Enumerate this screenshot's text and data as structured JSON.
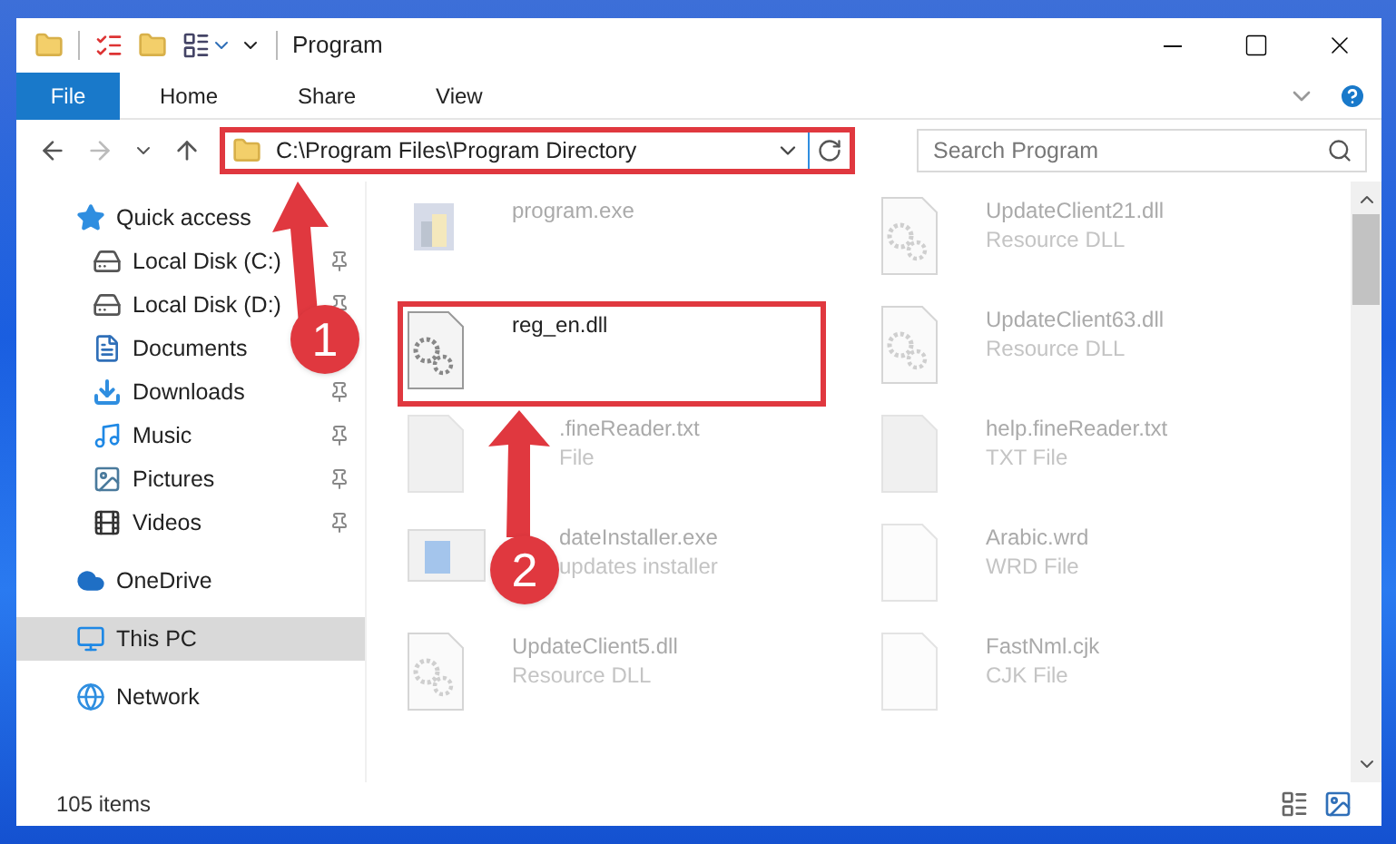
{
  "window": {
    "title": "Program"
  },
  "ribbon": {
    "tabs": [
      {
        "label": "File",
        "selected": true
      },
      {
        "label": "Home",
        "selected": false
      },
      {
        "label": "Share",
        "selected": false
      },
      {
        "label": "View",
        "selected": false
      }
    ]
  },
  "address": {
    "path": "C:\\Program Files\\Program Directory",
    "highlighted": true
  },
  "search": {
    "placeholder": "Search Program"
  },
  "sidebar": {
    "items": [
      {
        "label": "Quick access",
        "selected": false,
        "children": [
          {
            "label": "Local Disk (C:)",
            "pinned": true,
            "selected": false
          },
          {
            "label": "Local Disk (D:)",
            "pinned": true,
            "selected": false
          },
          {
            "label": "Documents",
            "selected": false
          },
          {
            "label": "Downloads",
            "pinned": true,
            "selected": false
          },
          {
            "label": "Music",
            "pinned": true,
            "selected": false
          },
          {
            "label": "Pictures",
            "pinned": true,
            "selected": false
          },
          {
            "label": "Videos",
            "pinned": true,
            "selected": false
          }
        ]
      },
      {
        "label": "OneDrive",
        "selected": false
      },
      {
        "label": "This PC",
        "selected": true
      },
      {
        "label": "Network",
        "selected": false
      }
    ]
  },
  "files": [
    {
      "name": "program.exe",
      "kind": "exe",
      "faded": true,
      "highlighted": false
    },
    {
      "name": "UpdateClient21.dll",
      "type": "Resource DLL",
      "kind": "dll",
      "faded": true,
      "highlighted": false
    },
    {
      "name": "reg_en.dll",
      "kind": "dll",
      "faded": false,
      "highlighted": true
    },
    {
      "name": "UpdateClient63.dll",
      "type": "Resource DLL",
      "kind": "dll",
      "faded": true,
      "highlighted": false
    },
    {
      "name": ".fineReader.txt",
      "type": "File",
      "kind": "txt",
      "faded": true,
      "highlighted": false
    },
    {
      "name": "help.fineReader.txt",
      "type": "TXT File",
      "kind": "txt",
      "faded": true,
      "highlighted": false
    },
    {
      "name": "dateInstaller.exe",
      "type": "updates installer",
      "kind": "installer",
      "faded": true,
      "highlighted": false
    },
    {
      "name": "Arabic.wrd",
      "type": "WRD File",
      "kind": "blank",
      "faded": true,
      "highlighted": false
    },
    {
      "name": "UpdateClient5.dll",
      "type": "Resource DLL",
      "kind": "dll",
      "faded": true,
      "highlighted": false
    },
    {
      "name": "FastNml.cjk",
      "type": "CJK File",
      "kind": "blank",
      "faded": true,
      "highlighted": false
    }
  ],
  "status_bar": {
    "count": "105 items"
  },
  "callouts": [
    {
      "number": "1"
    },
    {
      "number": "2"
    }
  ]
}
